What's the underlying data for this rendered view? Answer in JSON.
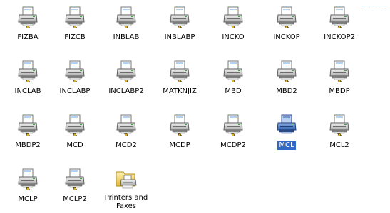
{
  "window": {
    "view_mode": "icons"
  },
  "colors": {
    "selection_bg": "#316ac5",
    "selection_fg": "#ffffff",
    "background": "#ffffff",
    "printer_body": "#d8d8d8",
    "printer_selected": "#4a7fd0"
  },
  "items": [
    {
      "label": "FIZBA",
      "icon": "printer-icon",
      "selected": false
    },
    {
      "label": "FIZCB",
      "icon": "printer-icon",
      "selected": false
    },
    {
      "label": "INBLAB",
      "icon": "printer-icon",
      "selected": false
    },
    {
      "label": "INBLABP",
      "icon": "printer-icon",
      "selected": false
    },
    {
      "label": "INCKO",
      "icon": "printer-icon",
      "selected": false
    },
    {
      "label": "INCKOP",
      "icon": "printer-icon",
      "selected": false
    },
    {
      "label": "INCKOP2",
      "icon": "printer-icon",
      "selected": false
    },
    {
      "label": "INCLAB",
      "icon": "printer-icon",
      "selected": false
    },
    {
      "label": "INCLABP",
      "icon": "printer-icon",
      "selected": false
    },
    {
      "label": "INCLABP2",
      "icon": "printer-icon",
      "selected": false
    },
    {
      "label": "MATKNJIZ",
      "icon": "printer-icon",
      "selected": false
    },
    {
      "label": "MBD",
      "icon": "printer-icon",
      "selected": false
    },
    {
      "label": "MBD2",
      "icon": "printer-icon",
      "selected": false
    },
    {
      "label": "MBDP",
      "icon": "printer-icon",
      "selected": false
    },
    {
      "label": "MBDP2",
      "icon": "printer-icon",
      "selected": false
    },
    {
      "label": "MCD",
      "icon": "printer-icon",
      "selected": false
    },
    {
      "label": "MCD2",
      "icon": "printer-icon",
      "selected": false
    },
    {
      "label": "MCDP",
      "icon": "printer-icon",
      "selected": false
    },
    {
      "label": "MCDP2",
      "icon": "printer-icon",
      "selected": false
    },
    {
      "label": "MCL",
      "icon": "printer-icon",
      "selected": true
    },
    {
      "label": "MCL2",
      "icon": "printer-icon",
      "selected": false
    },
    {
      "label": "MCLP",
      "icon": "printer-icon",
      "selected": false
    },
    {
      "label": "MCLP2",
      "icon": "printer-icon",
      "selected": false
    },
    {
      "label": "Printers and Faxes",
      "icon": "printers-and-faxes-folder-icon",
      "selected": false
    }
  ]
}
